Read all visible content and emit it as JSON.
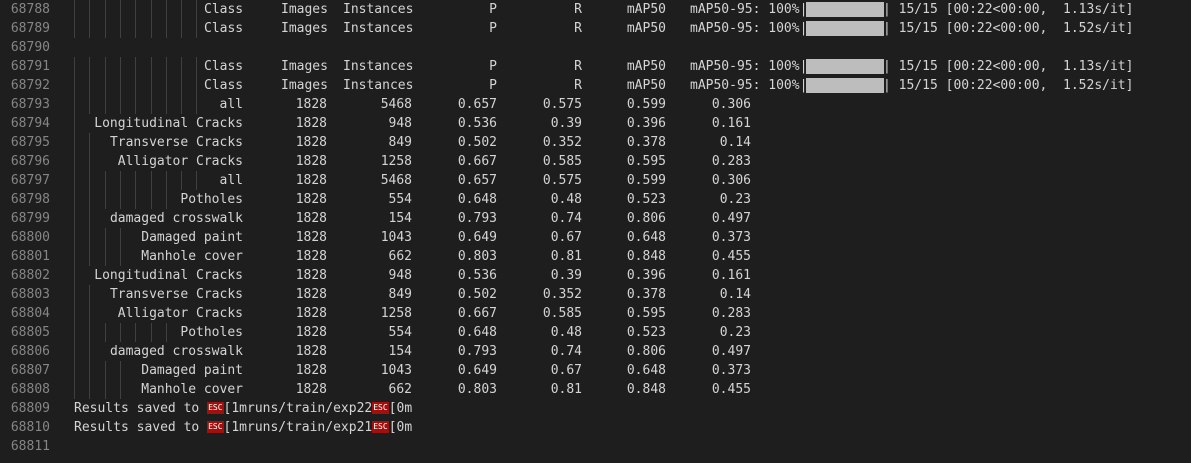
{
  "header_lines": [
    {
      "num": "68788",
      "cols": [
        "Class",
        "Images",
        "Instances",
        "P",
        "R",
        "mAP50",
        "mAP50-95: 100%|"
      ],
      "bar_fraction": 1.0,
      "progress": "| 15/15 [00:22<00:00,  1.13s/it]"
    },
    {
      "num": "68789",
      "cols": [
        "Class",
        "Images",
        "Instances",
        "P",
        "R",
        "mAP50",
        "mAP50-95: 100%|"
      ],
      "bar_fraction": 1.0,
      "progress": "| 15/15 [00:22<00:00,  1.52s/it]"
    },
    {
      "num": "68790"
    },
    {
      "num": "68791",
      "cols": [
        "Class",
        "Images",
        "Instances",
        "P",
        "R",
        "mAP50",
        "mAP50-95: 100%|"
      ],
      "bar_fraction": 1.0,
      "progress": "| 15/15 [00:22<00:00,  1.13s/it]"
    },
    {
      "num": "68792",
      "cols": [
        "Class",
        "Images",
        "Instances",
        "P",
        "R",
        "mAP50",
        "mAP50-95: 100%|"
      ],
      "bar_fraction": 1.0,
      "progress": "| 15/15 [00:22<00:00,  1.52s/it]"
    }
  ],
  "rows": [
    {
      "num": "68793",
      "cls": "all",
      "images": "1828",
      "instances": "5468",
      "p": "0.657",
      "r": "0.575",
      "map50": "0.599",
      "map5095": "0.306"
    },
    {
      "num": "68794",
      "cls": "Longitudinal Cracks",
      "images": "1828",
      "instances": "948",
      "p": "0.536",
      "r": "0.39",
      "map50": "0.396",
      "map5095": "0.161"
    },
    {
      "num": "68795",
      "cls": "Transverse Cracks",
      "images": "1828",
      "instances": "849",
      "p": "0.502",
      "r": "0.352",
      "map50": "0.378",
      "map5095": "0.14"
    },
    {
      "num": "68796",
      "cls": "Alligator Cracks",
      "images": "1828",
      "instances": "1258",
      "p": "0.667",
      "r": "0.585",
      "map50": "0.595",
      "map5095": "0.283"
    },
    {
      "num": "68797",
      "cls": "all",
      "images": "1828",
      "instances": "5468",
      "p": "0.657",
      "r": "0.575",
      "map50": "0.599",
      "map5095": "0.306"
    },
    {
      "num": "68798",
      "cls": "Potholes",
      "images": "1828",
      "instances": "554",
      "p": "0.648",
      "r": "0.48",
      "map50": "0.523",
      "map5095": "0.23"
    },
    {
      "num": "68799",
      "cls": "damaged crosswalk",
      "images": "1828",
      "instances": "154",
      "p": "0.793",
      "r": "0.74",
      "map50": "0.806",
      "map5095": "0.497"
    },
    {
      "num": "68800",
      "cls": "Damaged paint",
      "images": "1828",
      "instances": "1043",
      "p": "0.649",
      "r": "0.67",
      "map50": "0.648",
      "map5095": "0.373"
    },
    {
      "num": "68801",
      "cls": "Manhole cover",
      "images": "1828",
      "instances": "662",
      "p": "0.803",
      "r": "0.81",
      "map50": "0.848",
      "map5095": "0.455"
    },
    {
      "num": "68802",
      "cls": "Longitudinal Cracks",
      "images": "1828",
      "instances": "948",
      "p": "0.536",
      "r": "0.39",
      "map50": "0.396",
      "map5095": "0.161"
    },
    {
      "num": "68803",
      "cls": "Transverse Cracks",
      "images": "1828",
      "instances": "849",
      "p": "0.502",
      "r": "0.352",
      "map50": "0.378",
      "map5095": "0.14"
    },
    {
      "num": "68804",
      "cls": "Alligator Cracks",
      "images": "1828",
      "instances": "1258",
      "p": "0.667",
      "r": "0.585",
      "map50": "0.595",
      "map5095": "0.283"
    },
    {
      "num": "68805",
      "cls": "Potholes",
      "images": "1828",
      "instances": "554",
      "p": "0.648",
      "r": "0.48",
      "map50": "0.523",
      "map5095": "0.23"
    },
    {
      "num": "68806",
      "cls": "damaged crosswalk",
      "images": "1828",
      "instances": "154",
      "p": "0.793",
      "r": "0.74",
      "map50": "0.806",
      "map5095": "0.497"
    },
    {
      "num": "68807",
      "cls": "Damaged paint",
      "images": "1828",
      "instances": "1043",
      "p": "0.649",
      "r": "0.67",
      "map50": "0.648",
      "map5095": "0.373"
    },
    {
      "num": "68808",
      "cls": "Manhole cover",
      "images": "1828",
      "instances": "662",
      "p": "0.803",
      "r": "0.81",
      "map50": "0.848",
      "map5095": "0.455"
    }
  ],
  "results_lines": [
    {
      "num": "68809",
      "prefix": "Results saved to ",
      "esc": "ESC",
      "mid": "[1mruns/train/exp22",
      "end": "[0m"
    },
    {
      "num": "68810",
      "prefix": "Results saved to ",
      "esc": "ESC",
      "mid": "[1mruns/train/exp21",
      "end": "[0m"
    }
  ],
  "last_line": {
    "num": "68811"
  },
  "colors": {
    "background": "#1e1e1e",
    "text": "#d4d4d4",
    "line_number": "#858585",
    "esc_badge": "#a1100d",
    "progress_bar": "#bdbdbd"
  }
}
